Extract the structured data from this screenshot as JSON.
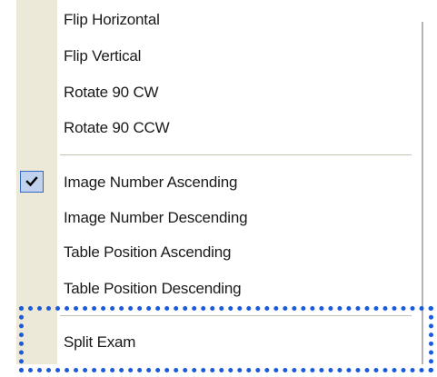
{
  "menu": {
    "items": [
      {
        "label": "Flip Horizontal",
        "checked": false
      },
      {
        "label": "Flip Vertical",
        "checked": false
      },
      {
        "label": "Rotate 90 CW",
        "checked": false
      },
      {
        "label": "Rotate 90 CCW",
        "checked": false
      },
      {
        "label": "Image Number Ascending",
        "checked": true
      },
      {
        "label": "Image Number Descending",
        "checked": false
      },
      {
        "label": "Table Position Ascending",
        "checked": false
      },
      {
        "label": "Table Position Descending",
        "checked": false
      },
      {
        "label": "Split Exam",
        "checked": false
      }
    ],
    "check_icon": "checkmark-icon",
    "highlighted_item": "Split Exam"
  },
  "colors": {
    "gutter": "#ece9d8",
    "check_background": "#c1d2ee",
    "check_border": "#316ac5",
    "focus_outline": "#1a5bdc"
  }
}
